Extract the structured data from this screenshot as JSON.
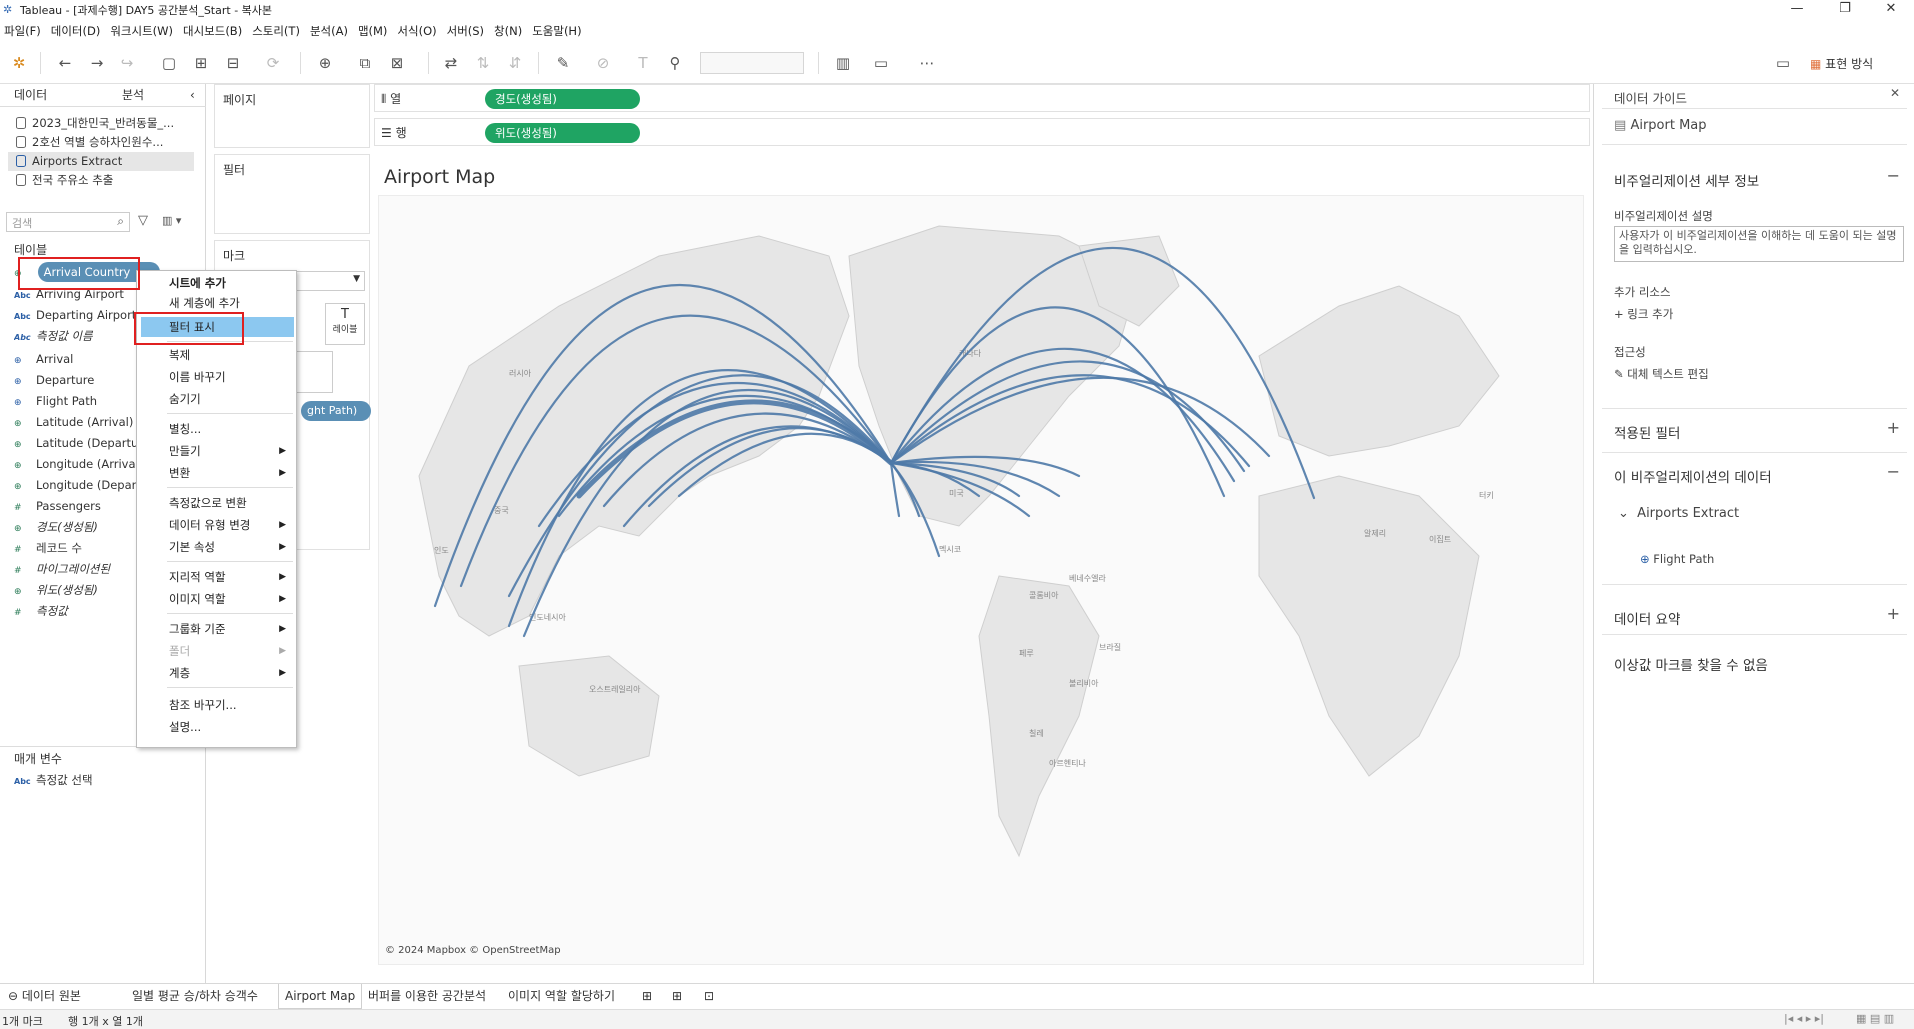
{
  "window": {
    "title": "Tableau - [과제수행] DAY5 공간분석_Start - 복사본",
    "min": "—",
    "max": "❐",
    "close": "✕"
  },
  "menu": [
    "파일(F)",
    "데이터(D)",
    "워크시트(W)",
    "대시보드(B)",
    "스토리(T)",
    "분석(A)",
    "맵(M)",
    "서식(O)",
    "서버(S)",
    "창(N)",
    "도움말(H)"
  ],
  "toolbar": {
    "show_me": "표현 방식"
  },
  "left": {
    "tab_data": "데이터",
    "tab_analysis": "분석",
    "sources": [
      "2023_대한민국_반려동물_...",
      "2호선 역별 승하차인원수...",
      "Airports Extract",
      "전국 주유소 추출"
    ],
    "search_placeholder": "검색",
    "tables_header": "테이블",
    "fields": [
      {
        "icon": "globe",
        "name": "Arrival Country"
      },
      {
        "icon": "abc",
        "name": "Arriving Airport"
      },
      {
        "icon": "abc",
        "name": "Departing Airport"
      },
      {
        "icon": "abc",
        "name": "측정값 이름"
      },
      {
        "icon": "geo",
        "name": "Arrival"
      },
      {
        "icon": "geo",
        "name": "Departure"
      },
      {
        "icon": "geo",
        "name": "Flight Path"
      },
      {
        "icon": "globe",
        "name": "Latitude (Arrival)"
      },
      {
        "icon": "globe",
        "name": "Latitude (Departure)"
      },
      {
        "icon": "globe",
        "name": "Longitude (Arrival)"
      },
      {
        "icon": "globe",
        "name": "Longitude (Departure)"
      },
      {
        "icon": "num",
        "name": "Passengers"
      },
      {
        "icon": "globe",
        "name": "경도(생성됨)"
      },
      {
        "icon": "num",
        "name": "레코드 수"
      },
      {
        "icon": "num",
        "name": "마이그레이션된"
      },
      {
        "icon": "globe",
        "name": "위도(생성됨)"
      },
      {
        "icon": "num",
        "name": "측정값"
      }
    ],
    "params_header": "매개 변수",
    "param": "측정값 선택"
  },
  "cards": {
    "pages": "페이지",
    "filters": "필터",
    "marks": "마크",
    "label_btn": "레이블",
    "pill_tail": "ght Path)"
  },
  "shelves": {
    "columns_label": "열",
    "rows_label": "행",
    "columns_pill": "경도(생성됨)",
    "rows_pill": "위도(생성됨)"
  },
  "viz": {
    "title": "Airport Map",
    "attribution": "© 2024 Mapbox © OpenStreetMap",
    "map_labels": [
      "러시아",
      "중국",
      "인도",
      "인도네시아",
      "오스트레일리아",
      "미국",
      "캐나다",
      "멕시코",
      "브라질",
      "페루",
      "볼리비아",
      "칠레",
      "아르헨티나",
      "알제리",
      "이집트",
      "터키",
      "콜롬비아",
      "베네수엘라"
    ]
  },
  "context_menu": {
    "items": [
      "시트에 추가",
      "새 계층에 추가",
      "필터 표시",
      "복제",
      "이름 바꾸기",
      "숨기기",
      "별칭...",
      "만들기",
      "변환",
      "측정값으로 변환",
      "데이터 유형 변경",
      "기본 속성",
      "지리적 역할",
      "이미지 역할",
      "그룹화 기준",
      "폴더",
      "계층",
      "참조 바꾸기...",
      "설명..."
    ]
  },
  "right": {
    "guide_title": "데이터 가이드",
    "sheet_name": "Airport Map",
    "viz_details": "비주얼리제이션 세부 정보",
    "desc_label": "비주얼리제이션 설명",
    "desc_placeholder": "사용자가 이 비주얼리제이션을 이해하는 데 도움이 되는 설명을 입력하십시오.",
    "resources_label": "추가 리소스",
    "add_link": "링크 추가",
    "accessibility_label": "접근성",
    "alt_text": "대체 텍스트 편집",
    "applied_filters": "적용된 필터",
    "viz_data": "이 비주얼리제이션의 데이터",
    "datasource": "Airports Extract",
    "field": "Flight Path",
    "data_summary": "데이터 요약",
    "outliers": "이상값 마크를 찾을 수 없음"
  },
  "tabs": {
    "datasource": "데이터 원본",
    "sheets": [
      "일별 평균 승/하차 승객수",
      "Airport Map",
      "버퍼를 이용한 공간분석",
      "이미지 역할 할당하기"
    ],
    "active_sheet": "Airport Map"
  },
  "status": {
    "marks": "1개 마크",
    "rows_cols": "행 1개 x 열 1개"
  },
  "colors": {
    "accent_pill": "#1fa463",
    "selected_field": "#5a8fb5",
    "flight_path": "#4e79a7",
    "menu_highlight": "#8cc8f0",
    "red_box": "#e02020"
  }
}
